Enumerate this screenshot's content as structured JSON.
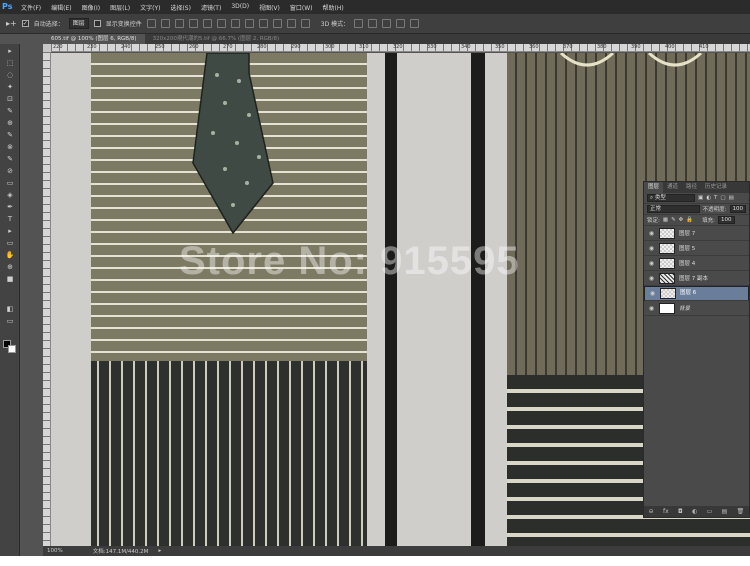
{
  "app": {
    "logo": "Ps"
  },
  "menu": [
    "文件(F)",
    "编辑(E)",
    "图像(I)",
    "图层(L)",
    "文字(Y)",
    "选择(S)",
    "滤镜(T)",
    "3D(D)",
    "视图(V)",
    "窗口(W)",
    "帮助(H)"
  ],
  "options": {
    "auto_select_label": "自动选择：",
    "auto_select_value": "图层",
    "show_transform_label": "显示变换控件",
    "mode_3d": "3D 模式："
  },
  "tabs": [
    {
      "label": "605.tif @ 100% (图层 6, RGB/8)",
      "active": true
    },
    {
      "label": "320x200現代潮的5.tif @ 66.7% (图层 2, RGB/8)",
      "active": false
    }
  ],
  "ruler": {
    "h_ticks": [
      "220",
      "230",
      "240",
      "250",
      "260",
      "270",
      "280",
      "290",
      "300",
      "310",
      "320",
      "330",
      "340",
      "350",
      "360",
      "370",
      "380",
      "390",
      "400",
      "410"
    ]
  },
  "watermark": "Store No: 915595",
  "status": {
    "zoom": "100%",
    "doc": "文档:147.1M/440.2M"
  },
  "layers_panel": {
    "tabs": [
      "图层",
      "通道",
      "路径",
      "历史记录"
    ],
    "filter": "类型",
    "blend_mode": "正常",
    "opacity_label": "不透明度:",
    "opacity_value": "100",
    "lock_label": "锁定:",
    "fill_label": "填充:",
    "fill_value": "100",
    "layers": [
      {
        "name": "图层 7",
        "thumb": "transparent",
        "selected": false
      },
      {
        "name": "图层 5",
        "thumb": "transparent",
        "selected": false
      },
      {
        "name": "图层 4",
        "thumb": "transparent",
        "selected": false
      },
      {
        "name": "图层 7 副本",
        "thumb": "pattern",
        "selected": false
      },
      {
        "name": "图层 6",
        "thumb": "transparent",
        "selected": true
      },
      {
        "name": "背景",
        "thumb": "white",
        "selected": false
      }
    ],
    "footer_icons": [
      "⊖",
      "fx",
      "◘",
      "◐",
      "▭",
      "▤",
      "🗑"
    ]
  },
  "tools": [
    "▸",
    "⬚",
    "◌",
    "✦",
    "⊡",
    "✎",
    "⊕",
    "✎",
    "⊗",
    "✎",
    "⊘",
    "▭",
    "◈",
    "✒",
    "T",
    "▸",
    "▭",
    "✋",
    "⊕",
    "■",
    "◧",
    "▭"
  ]
}
